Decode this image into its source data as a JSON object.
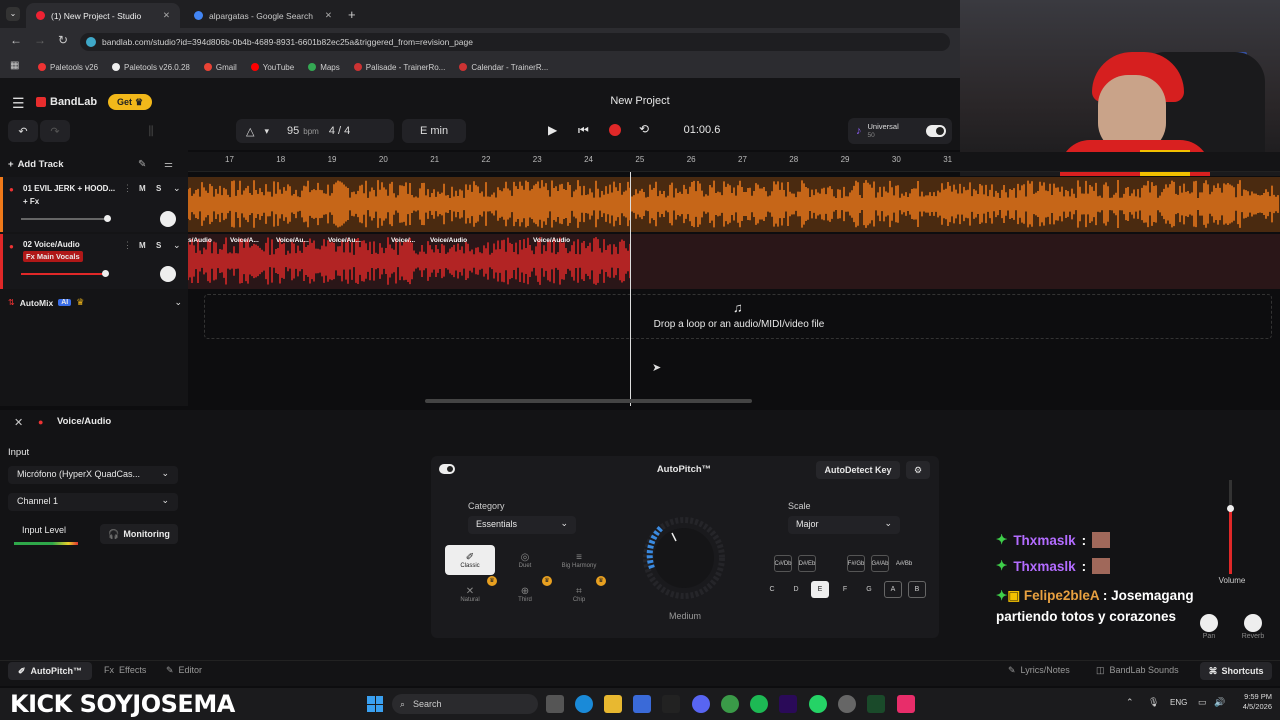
{
  "browser": {
    "tabs": [
      {
        "title": "(1) New Project - Studio"
      },
      {
        "title": "alpargatas - Google Search"
      }
    ],
    "url": "bandlab.com/studio?id=394d806b-0b4b-4689-8931-6601b82ec25a&triggered_from=revision_page",
    "bookmarks": [
      "Paletools v26",
      "Paletools v26.0.28",
      "Gmail",
      "YouTube",
      "Maps",
      "Palisade - TrainerRo...",
      "Calendar - TrainerR..."
    ]
  },
  "app": {
    "logo": "BandLab",
    "get_label": "Get",
    "title": "New Project",
    "bpm": "95",
    "bpm_unit": "bpm",
    "time_sig": "4 / 4",
    "key": "E min",
    "time": "01:00.6",
    "universal_label": "Universal",
    "universal_sub": "50",
    "add_track": "Add Track"
  },
  "ruler": [
    "17",
    "18",
    "19",
    "20",
    "21",
    "22",
    "23",
    "24",
    "25",
    "26",
    "27",
    "28",
    "29",
    "30",
    "31"
  ],
  "tracks": [
    {
      "name": "01  EVIL JERK + HOOD...",
      "fx": "+ Fx",
      "m": "M",
      "s": "S",
      "color": "#f07a1a"
    },
    {
      "name": "02  Voice/Audio",
      "fx": "Fx  Main Vocals",
      "m": "M",
      "s": "S",
      "color": "#e02828"
    }
  ],
  "clips": [
    "s/Audio",
    "Voice/A...",
    "Voice/Au...",
    "Voice/Au...",
    "Voice/...",
    "Voice/Audio",
    "Voice/Audio"
  ],
  "automix": {
    "label": "AutoMix",
    "badge": "AI"
  },
  "drop_text": "Drop a loop or an audio/MIDI/video file",
  "panel": {
    "title": "Voice/Audio",
    "input_label": "Input",
    "device": "Micrófono (HyperX QuadCas...",
    "channel": "Channel 1",
    "input_level": "Input Level",
    "monitoring": "Monitoring"
  },
  "autopitch": {
    "title": "AutoPitch™",
    "autodetect": "AutoDetect Key",
    "category_label": "Category",
    "category_value": "Essentials",
    "scale_label": "Scale",
    "scale_value": "Major",
    "styles": [
      "Classic",
      "Duet",
      "Big Harmony",
      "Natural",
      "Third",
      "Chip"
    ],
    "knob_label": "Medium",
    "keys": [
      "C",
      "D",
      "E",
      "F",
      "G",
      "A",
      "B"
    ],
    "sharps": [
      "C#/Db",
      "D#/Eb",
      "F#/Gb",
      "G#/Ab",
      "A#/Bb"
    ]
  },
  "mixer": {
    "volume": "Volume",
    "pan": "Pan",
    "reverb": "Reverb"
  },
  "chat": [
    {
      "user": "Thxmaslk",
      "text": ":",
      "color": "#b36cff"
    },
    {
      "user": "Thxmaslk",
      "text": ":",
      "color": "#b36cff"
    },
    {
      "user": "Felipe2bleA",
      "text": ": Josemagang partiendo totos y corazones",
      "color": "#e8a040"
    }
  ],
  "footer": {
    "autopitch": "AutoPitch™",
    "effects": "Effects",
    "editor": "Editor",
    "lyrics": "Lyrics/Notes",
    "sounds": "BandLab Sounds",
    "shortcuts": "Shortcuts"
  },
  "overlay": {
    "brand": "KICK SOYJOSEMA"
  },
  "taskbar": {
    "search": "Search",
    "lang": "ENG",
    "time": "9:59 PM",
    "date": "4/5/2026"
  }
}
